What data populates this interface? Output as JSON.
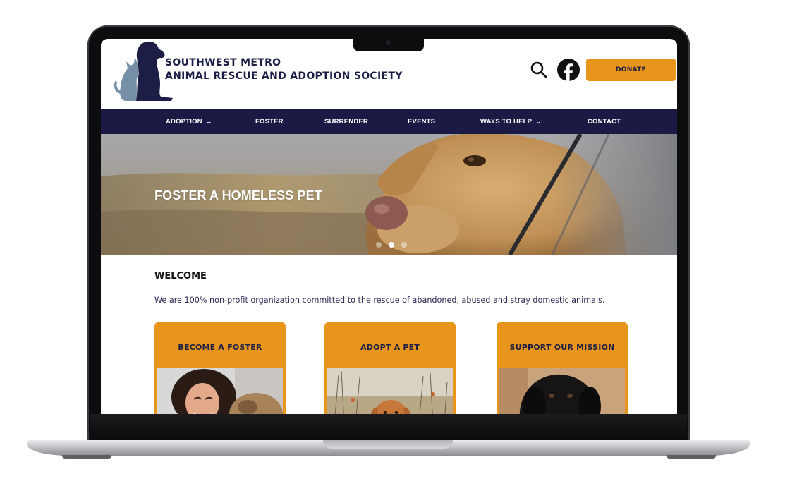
{
  "org": {
    "name_line1": "SOUTHWEST METRO",
    "name_line2": "ANIMAL RESCUE AND ADOPTION SOCIETY",
    "logo_icon": "dog-and-cat-silhouette-icon"
  },
  "header": {
    "search_icon": "search-icon",
    "social_icon": "facebook-icon",
    "donate_label": "DONATE"
  },
  "nav": {
    "items": [
      {
        "label": "ADOPTION",
        "has_dropdown": true
      },
      {
        "label": "FOSTER",
        "has_dropdown": false
      },
      {
        "label": "SURRENDER",
        "has_dropdown": false
      },
      {
        "label": "EVENTS",
        "has_dropdown": false
      },
      {
        "label": "WAYS TO HELP",
        "has_dropdown": true
      },
      {
        "label": "CONTACT",
        "has_dropdown": false
      }
    ]
  },
  "hero": {
    "title": "FOSTER A HOMELESS PET",
    "slide_count": 3,
    "active_slide": 2
  },
  "welcome": {
    "heading": "WELCOME",
    "text": "We are 100% non-profit organization committed to the rescue of abandoned, abused and stray domestic animals."
  },
  "cards": [
    {
      "title": "BECOME A FOSTER"
    },
    {
      "title": "ADOPT A PET"
    },
    {
      "title": "SUPPORT OUR MISSION"
    }
  ],
  "colors": {
    "navy": "#1a1a45",
    "accent_orange": "#e8951b",
    "text_navy": "#1d1e45",
    "logo_blue_gray": "#7590a6"
  }
}
